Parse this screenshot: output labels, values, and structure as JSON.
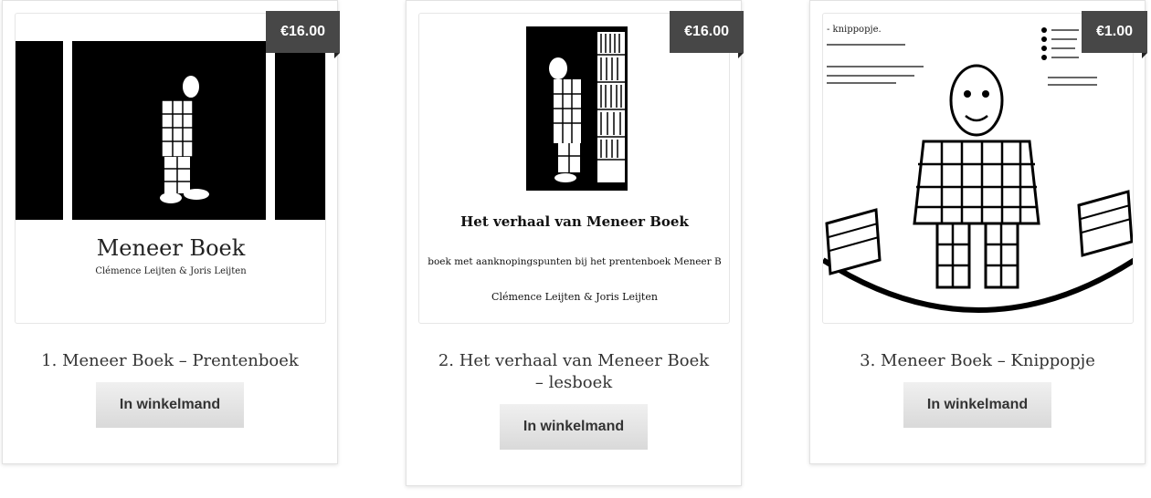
{
  "products": [
    {
      "price": "€16.00",
      "title": "1. Meneer Boek – Prentenboek",
      "button": "In winkelmand",
      "cover_title": "Meneer Boek",
      "cover_authors": "Clémence Leijten & Joris Leijten"
    },
    {
      "price": "€16.00",
      "title": "2. Het verhaal van Meneer Boek – lesboek",
      "button": "In winkelmand",
      "cover_title": "Het verhaal van Meneer Boek",
      "cover_subtitle": "boek met aanknopingspunten bij het prentenboek Meneer B",
      "cover_authors": "Clémence Leijten & Joris Leijten"
    },
    {
      "price": "€1.00",
      "title": "3. Meneer Boek – Knippopje",
      "button": "In winkelmand",
      "cover_heading": "- knippopje."
    }
  ]
}
